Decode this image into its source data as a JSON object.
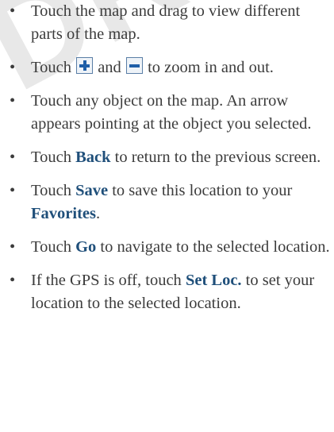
{
  "watermark": "DRAFT",
  "steps": {
    "s1": {
      "text": "Touch the map and drag to view different parts of the map."
    },
    "s2": {
      "pre": "Touch",
      "mid": "and",
      "post": "to zoom in and out.",
      "icon1": "plus-icon",
      "icon2": "minus-icon"
    },
    "s3": {
      "text": "Touch any object on the map. An arrow appears pointing at the object you selected."
    },
    "s4": {
      "pre": "Touch",
      "kw": "Back",
      "post": "to return to the previous screen."
    },
    "s5": {
      "pre": "Touch",
      "kw": "Save",
      "mid": "to save this location to your",
      "kw2": "Favorites",
      "post": "."
    },
    "s6": {
      "pre": "Touch",
      "kw": "Go",
      "post": "to navigate to the selected location."
    },
    "s7": {
      "pre": "If the GPS is off, touch",
      "kw": "Set Loc.",
      "post": "to set your location to the selected location."
    }
  },
  "colors": {
    "keyword": "#1f4f7a",
    "text": "#3c3c3c",
    "icon": "#1f5fa8"
  }
}
